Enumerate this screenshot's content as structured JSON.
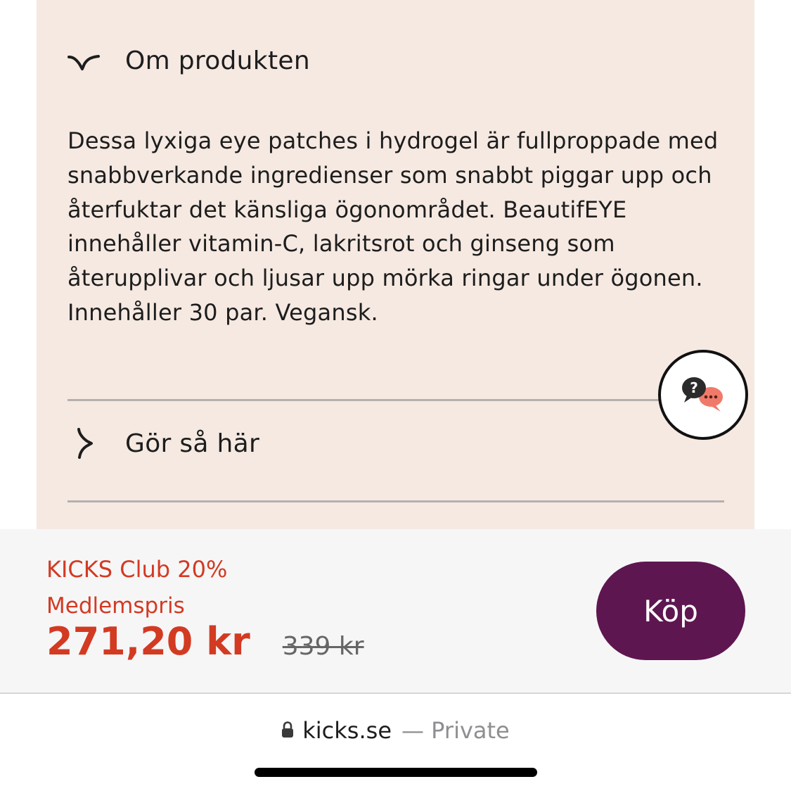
{
  "accordion": {
    "about": {
      "title": "Om produkten",
      "state": "expanded",
      "icon": "chevron-down-icon",
      "description": "Dessa lyxiga eye patches i hydrogel är fullproppade med snabbverkande ingredienser som snabbt piggar upp och återfuktar det känsliga ögonområdet. BeautifEYE innehåller vitamin-C, lakritsrot och ginseng som återupplivar och ljusar upp mörka ringar under ögonen. Innehåller 30 par. Vegansk."
    },
    "howto": {
      "title": "Gör så här",
      "state": "collapsed",
      "icon": "chevron-right-icon"
    }
  },
  "chat": {
    "icon": "help-chat-icon",
    "question_mark": "?"
  },
  "purchase": {
    "club_label": "KICKS Club 20%",
    "member_label": "Medlemspris",
    "price_now": "271,20 kr",
    "price_old": "339 kr",
    "buy_label": "Köp"
  },
  "browser": {
    "lock_icon": "lock-icon",
    "domain": "kicks.se",
    "mode": "— Private"
  },
  "colors": {
    "panel_bg": "#f5e9e2",
    "accent_red": "#d33a22",
    "buy_button": "#5e1650",
    "chat_red": "#f07a6a"
  }
}
